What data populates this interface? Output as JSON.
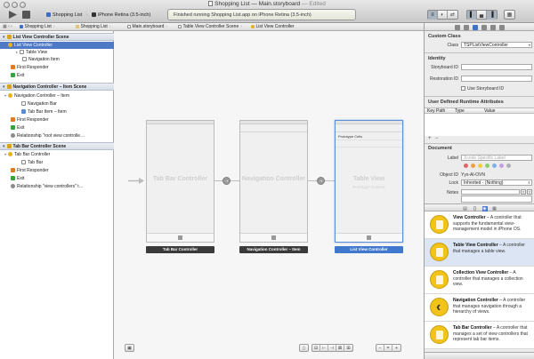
{
  "window": {
    "title": "Shopping List",
    "file": "Main.storyboard",
    "edited": "— Edited"
  },
  "toolbar": {
    "scheme": "Shopping List",
    "device": "iPhone Retina (3.5-inch)",
    "status": "Finished running Shopping List.app on iPhone Retina (3.5-inch)"
  },
  "jumpbar": {
    "crumbs": [
      "Shopping List",
      "Shopping List",
      "Main.storyboard",
      "Table View Controller Scene",
      "List View Controller"
    ]
  },
  "outline": {
    "scenes": [
      {
        "title": "List View Controller Scene",
        "items": [
          "List View Controller",
          "Table View",
          "Navigation Item",
          "First Responder",
          "Exit"
        ]
      },
      {
        "title": "Navigation Controller – Item Scene",
        "items": [
          "Navigation Controller – Item",
          "Navigation Bar",
          "Tab Bar Item – Item",
          "First Responder",
          "Exit",
          "Relationship \"root view controlle…"
        ]
      },
      {
        "title": "Tab Bar Controller Scene",
        "items": [
          "Tab Bar Controller",
          "Tab Bar",
          "First Responder",
          "Exit",
          "Relationship \"view controllers\" t…"
        ]
      }
    ]
  },
  "canvas": {
    "scenes": [
      {
        "label": "Tab Bar Controller",
        "caption": "Tab Bar Controller"
      },
      {
        "label": "Navigation Controller",
        "caption": "Navigation Controller – Item"
      },
      {
        "label": "Table View",
        "sub": "Prototype Content",
        "cell": "Prototype Cells",
        "caption": "List View Controller"
      }
    ]
  },
  "inspector": {
    "custom_class": {
      "title": "Custom Class",
      "class_label": "Class",
      "class_value": "TSPListViewController"
    },
    "identity": {
      "title": "Identity",
      "storyboard_label": "Storyboard ID",
      "restoration_label": "Restoration ID",
      "use_storyboard": "Use Storyboard ID"
    },
    "runtime": {
      "title": "User Defined Runtime Attributes",
      "col_key": "Key Path",
      "col_type": "Type",
      "col_value": "Value",
      "add": "+",
      "remove": "−"
    },
    "document": {
      "title": "Document",
      "label_label": "Label",
      "label_placeholder": "Xcode Specific Label",
      "object_id_label": "Object ID",
      "object_id_value": "Yyx-Al-OVN",
      "lock_label": "Lock",
      "lock_value": "Inherited - (Nothing)",
      "notes_label": "Notes"
    },
    "swatch_colors": [
      "#e06666",
      "#f0a040",
      "#f0d040",
      "#8fcf6f",
      "#7fb0e8",
      "#c59fe0",
      "#b0b0b0"
    ]
  },
  "library": {
    "items": [
      {
        "name": "View Controller",
        "desc": " – A controller that supports the fundamental view-management model in iPhone OS."
      },
      {
        "name": "Table View Controller",
        "desc": " – A controller that manages a table view."
      },
      {
        "name": "Collection View Controller",
        "desc": " – A controller that manages a collection view."
      },
      {
        "name": "Navigation Controller",
        "desc": " – A controller that manages navigation through a hierarchy of views."
      },
      {
        "name": "Tab Bar Controller",
        "desc": " – A controller that manages a set of view controllers that represent tab bar items."
      }
    ]
  }
}
